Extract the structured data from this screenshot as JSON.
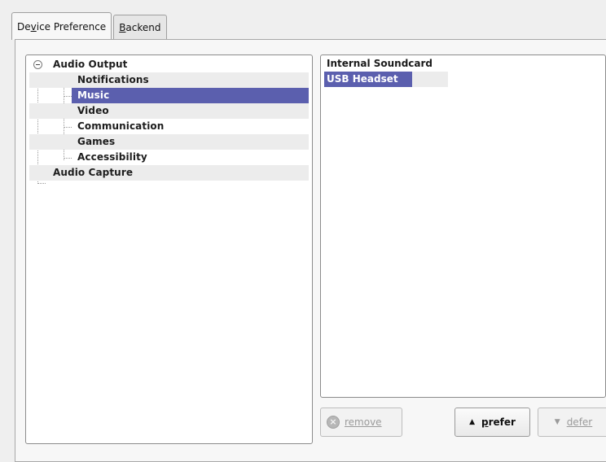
{
  "tabs": [
    {
      "pre": "De",
      "mn": "v",
      "post": "ice Preference",
      "active": true
    },
    {
      "pre": "",
      "mn": "B",
      "post": "ackend",
      "active": false
    }
  ],
  "tree": {
    "root1": "Audio Output",
    "children": [
      "Notifications",
      "Music",
      "Video",
      "Communication",
      "Games",
      "Accessibility"
    ],
    "root2": "Audio Capture",
    "selected": "Music"
  },
  "devices": {
    "items": [
      "Internal Soundcard",
      "USB Headset"
    ],
    "selected": "USB Headset"
  },
  "buttons": {
    "remove": {
      "label": "remove",
      "enabled": false
    },
    "prefer": {
      "pre": "",
      "mn": "p",
      "post": "refer",
      "enabled": true
    },
    "defer": {
      "label": "defer",
      "enabled": false
    }
  },
  "icons": {
    "remove": "remove-circle-icon",
    "prefer": "arrow-up-icon",
    "defer": "arrow-down-icon",
    "expander": "collapse-icon"
  }
}
